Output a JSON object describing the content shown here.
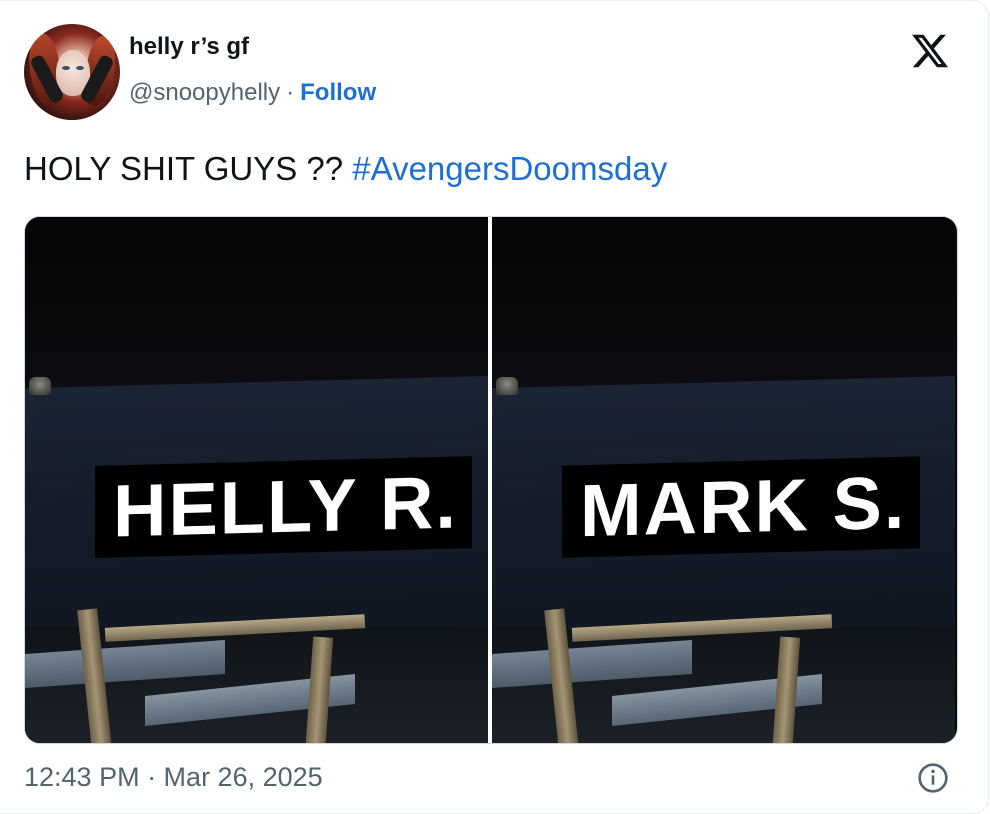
{
  "author": {
    "display_name": "helly r’s gf",
    "handle": "@snoopyhelly",
    "separator": "·",
    "follow_label": "Follow",
    "avatar_icon": "profile-photo"
  },
  "platform": {
    "logo_icon": "x-logo-icon"
  },
  "tweet": {
    "text": "HOLY SHIT GUYS ??",
    "hashtag": "#AvengersDoomsday"
  },
  "media": {
    "photos": [
      {
        "caption": "HELLY R."
      },
      {
        "caption": "MARK S."
      }
    ]
  },
  "footer": {
    "timestamp": "12:43 PM · Mar 26, 2025",
    "info_icon": "info-icon"
  },
  "colors": {
    "link": "#1d6fd6",
    "text": "#0f1419",
    "muted": "#536471",
    "border": "#cfd9de"
  }
}
